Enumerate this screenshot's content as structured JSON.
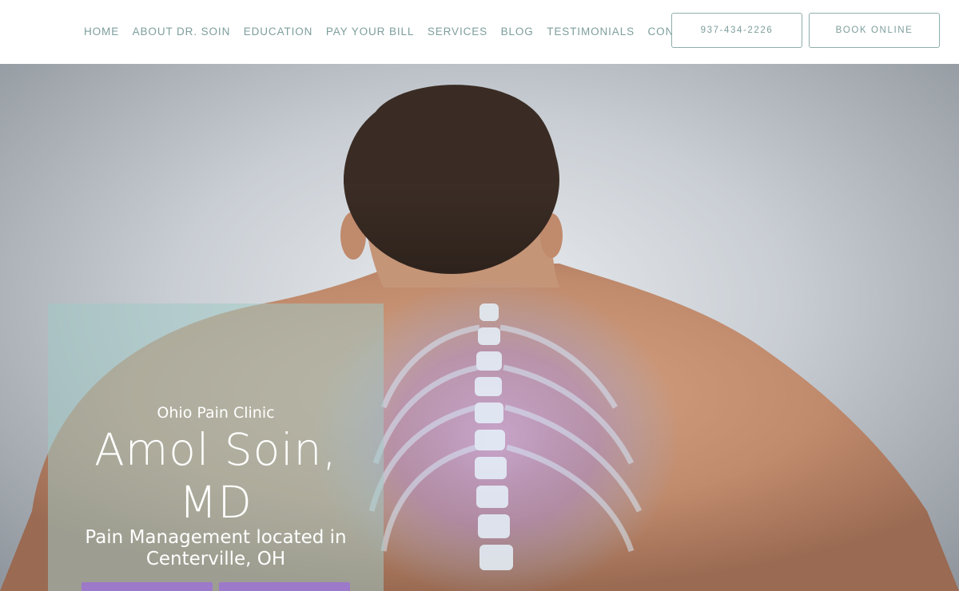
{
  "nav": {
    "items": [
      {
        "label": "HOME"
      },
      {
        "label": "ABOUT DR. SOIN"
      },
      {
        "label": "EDUCATION"
      },
      {
        "label": "PAY YOUR BILL"
      },
      {
        "label": "SERVICES"
      },
      {
        "label": "BLOG"
      },
      {
        "label": "TESTIMONIALS"
      },
      {
        "label": "CONTACT"
      }
    ]
  },
  "header": {
    "phone_label": "937-434-2226",
    "book_label": "BOOK ONLINE"
  },
  "hero": {
    "clinic_name": "Ohio Pain Clinic",
    "doctor_name": "Amol Soin, MD",
    "tagline": "Pain Management located in Centerville, OH"
  },
  "colors": {
    "nav_text": "#7d9e9c",
    "card_overlay": "#a0c8c4",
    "cta_purple": "#9c79c9"
  }
}
